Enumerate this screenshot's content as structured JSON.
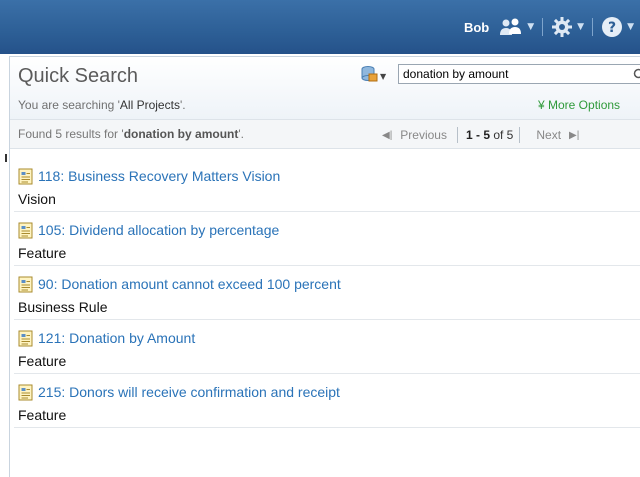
{
  "header": {
    "user_name": "Bob",
    "icons": {
      "users": "users-icon",
      "settings": "gear-icon",
      "help": "help-icon"
    }
  },
  "quick_search": {
    "title": "Quick Search",
    "scope_prefix": "You are searching '",
    "scope_value": "All Projects",
    "scope_suffix": "'.",
    "query": "donation by amount",
    "more_options": "¥ More Options"
  },
  "results_bar": {
    "found_prefix": "Found 5 results for '",
    "found_query": "donation by amount",
    "found_suffix": "'.",
    "previous": "Previous",
    "range": "1 - 5",
    "of_total": " of 5",
    "next": "Next"
  },
  "results": [
    {
      "title": "118: Business Recovery Matters Vision",
      "type": "Vision"
    },
    {
      "title": "105: Dividend allocation by percentage",
      "type": "Feature"
    },
    {
      "title": "90: Donation amount cannot exceed 100 percent",
      "type": "Business Rule"
    },
    {
      "title": "121: Donation by Amount",
      "type": "Feature"
    },
    {
      "title": "215: Donors will receive confirmation and receipt",
      "type": "Feature"
    }
  ],
  "colors": {
    "header_bg": "#2d5f96",
    "link": "#2a73b8",
    "more_options": "#2f9a3a"
  }
}
